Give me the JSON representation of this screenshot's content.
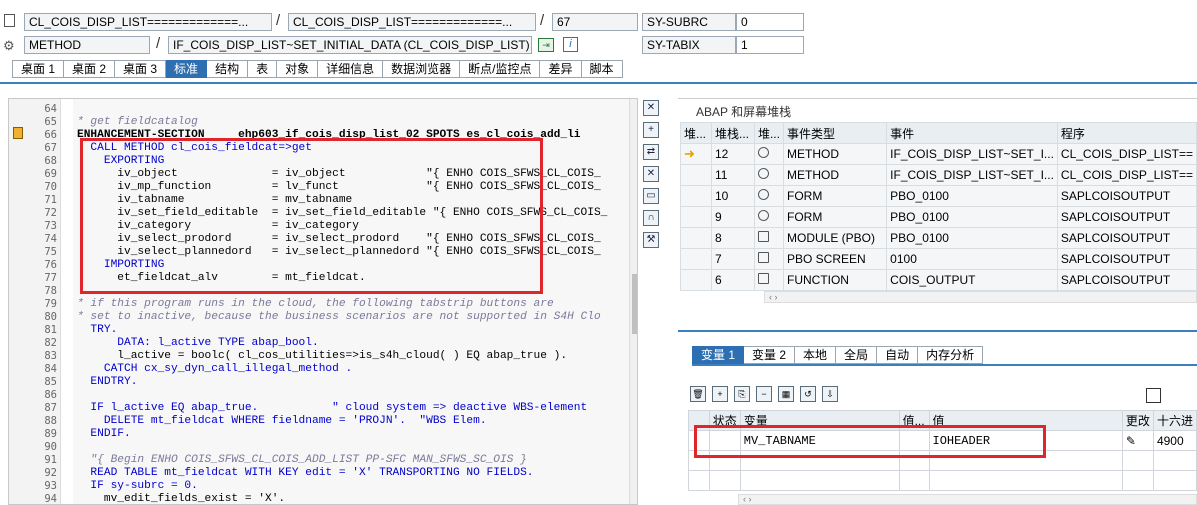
{
  "header": {
    "class_field": "CL_COIS_DISP_LIST=============...",
    "include_field": "CL_COIS_DISP_LIST=============...",
    "line_field": "67",
    "sy_subrc_label": "SY-SUBRC",
    "sy_subrc_value": "0",
    "type_field": "METHOD",
    "method_field": "IF_COIS_DISP_LIST~SET_INITIAL_DATA (CL_COIS_DISP_LIST)",
    "sy_tabix_label": "SY-TABIX",
    "sy_tabix_value": "1",
    "slash": "/"
  },
  "tabs": [
    "桌面 1",
    "桌面 2",
    "桌面 3",
    "标准",
    "结构",
    "表",
    "对象",
    "详细信息",
    "数据浏览器",
    "断点/监控点",
    "差异",
    "脚本"
  ],
  "code": {
    "line_numbers": [
      "64",
      "65",
      "66",
      "67",
      "68",
      "69",
      "70",
      "71",
      "72",
      "73",
      "74",
      "75",
      "76",
      "77",
      "78",
      "79",
      "80",
      "81",
      "82",
      "83",
      "84",
      "85",
      "86",
      "87",
      "88",
      "89",
      "90",
      "91",
      "92",
      "93",
      "94"
    ],
    "lines": [
      "",
      "* get fieldcatalog",
      "ENHANCEMENT-SECTION     ehp603_if_cois_disp_list_02 SPOTS es_cl_cois_add_li",
      "  CALL METHOD cl_cois_fieldcat=>get",
      "    EXPORTING",
      "      iv_object              = iv_object            \"{ ENHO COIS_SFWS_CL_COIS_",
      "      iv_mp_function         = lv_funct             \"{ ENHO COIS_SFWS_CL_COIS_",
      "      iv_tabname             = mv_tabname",
      "      iv_set_field_editable  = iv_set_field_editable \"{ ENHO COIS_SFWS_CL_COIS_",
      "      iv_category            = iv_category",
      "      iv_select_prodord      = iv_select_prodord    \"{ ENHO COIS_SFWS_CL_COIS_",
      "      iv_select_plannedord   = iv_select_plannedord \"{ ENHO COIS_SFWS_CL_COIS_",
      "    IMPORTING",
      "      et_fieldcat_alv        = mt_fieldcat.",
      "",
      "* if this program runs in the cloud, the following tabstrip buttons are",
      "* set to inactive, because the business scenarios are not supported in S4H Clo",
      "  TRY.",
      "      DATA: l_active TYPE abap_bool.",
      "      l_active = boolc( cl_cos_utilities=>is_s4h_cloud( ) EQ abap_true ).",
      "    CATCH cx_sy_dyn_call_illegal_method .",
      "  ENDTRY.",
      "",
      "  IF l_active EQ abap_true.           \" cloud system => deactive WBS-element",
      "    DELETE mt_fieldcat WHERE fieldname = 'PROJN'.  \"WBS Elem.",
      "  ENDIF.",
      "",
      "  \"{ Begin ENHO COIS_SFWS_CL_COIS_ADD_LIST PP-SFC MAN_SFWS_SC_OIS }",
      "  READ TABLE mt_fieldcat WITH KEY edit = 'X' TRANSPORTING NO FIELDS.",
      "  IF sy-subrc = 0.",
      "    mv_edit_fields_exist = 'X'."
    ]
  },
  "stack": {
    "title": "ABAP 和屏幕堆栈",
    "headers": [
      "堆...",
      "堆栈...",
      "堆...",
      "事件类型",
      "事件",
      "程序"
    ],
    "rows": [
      {
        "level": "12",
        "type": "METHOD",
        "event": "IF_COIS_DISP_LIST~SET_I...",
        "program": "CL_COIS_DISP_LIST=="
      },
      {
        "level": "11",
        "type": "METHOD",
        "event": "IF_COIS_DISP_LIST~SET_I...",
        "program": "CL_COIS_DISP_LIST=="
      },
      {
        "level": "10",
        "type": "FORM",
        "event": "PBO_0100",
        "program": "SAPLCOISOUTPUT"
      },
      {
        "level": "9",
        "type": "FORM",
        "event": "PBO_0100",
        "program": "SAPLCOISOUTPUT"
      },
      {
        "level": "8",
        "type": "MODULE (PBO)",
        "event": "PBO_0100",
        "program": "SAPLCOISOUTPUT"
      },
      {
        "level": "7",
        "type": "PBO SCREEN",
        "event": "0100",
        "program": "SAPLCOISOUTPUT"
      },
      {
        "level": "6",
        "type": "FUNCTION",
        "event": "COIS_OUTPUT",
        "program": "SAPLCOISOUTPUT"
      }
    ]
  },
  "var_tabs": [
    "变量 1",
    "变量 2",
    "本地",
    "全局",
    "自动",
    "内存分析"
  ],
  "var_table": {
    "headers": [
      "状态",
      "变量",
      "值...",
      "值",
      "更改",
      "十六进"
    ],
    "row": {
      "variable": "MV_TABNAME",
      "value": "IOHEADER",
      "hex": "4900"
    }
  }
}
